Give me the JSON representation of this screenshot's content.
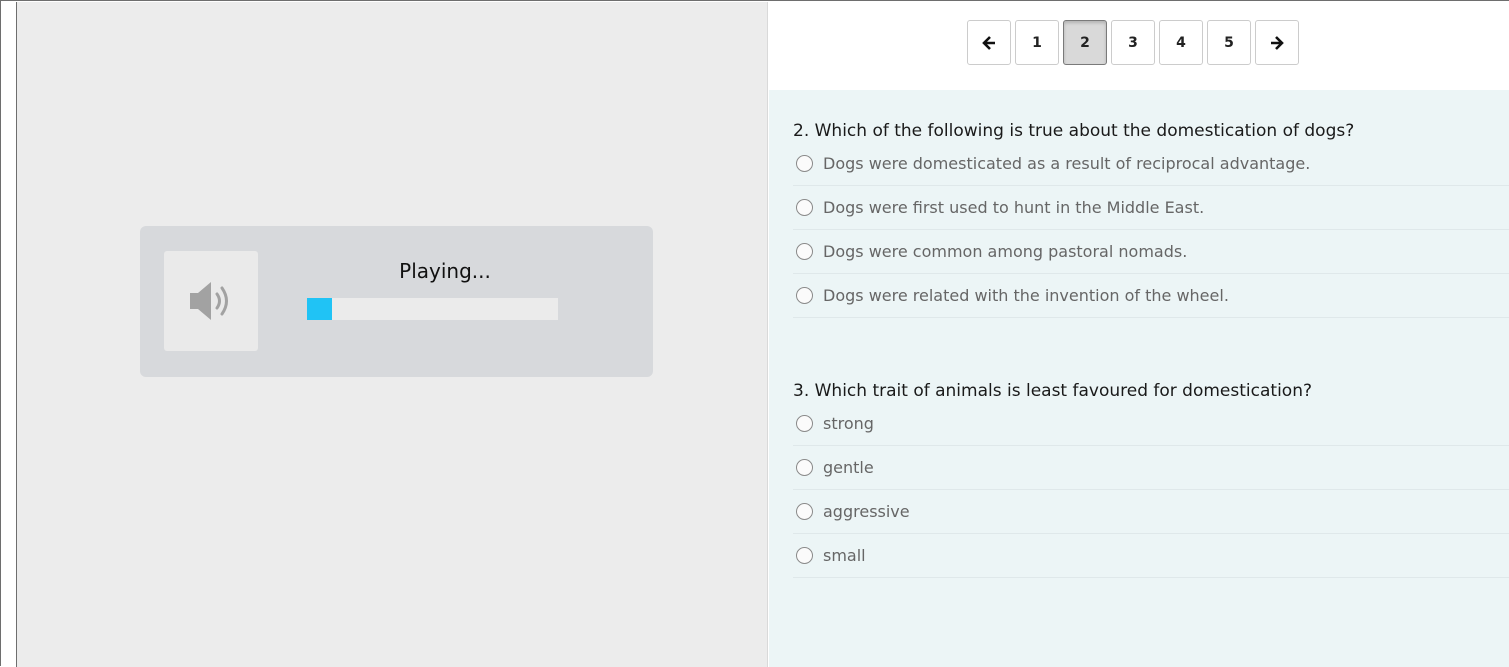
{
  "player": {
    "status": "Playing...",
    "progress_fraction": 0.1,
    "icon": "speaker-icon"
  },
  "pager": {
    "prev_icon": "arrow-left-icon",
    "next_icon": "arrow-right-icon",
    "pages": [
      "1",
      "2",
      "3",
      "4",
      "5"
    ],
    "active_page": "2"
  },
  "questions": [
    {
      "text": "2. Which of the following is true about the domestication of dogs?",
      "options": [
        "Dogs were domesticated as a result of reciprocal advantage.",
        "Dogs were first used to hunt in the Middle East.",
        "Dogs were common among pastoral nomads.",
        "Dogs were related with the invention of the wheel."
      ]
    },
    {
      "text": "3. Which trait of animals is least favoured for domestication?",
      "options": [
        "strong",
        "gentle",
        "aggressive",
        "small"
      ]
    }
  ],
  "colors": {
    "progress_fill": "#20c3f5",
    "question_bg": "#ecf5f6",
    "left_bg": "#ececec"
  }
}
